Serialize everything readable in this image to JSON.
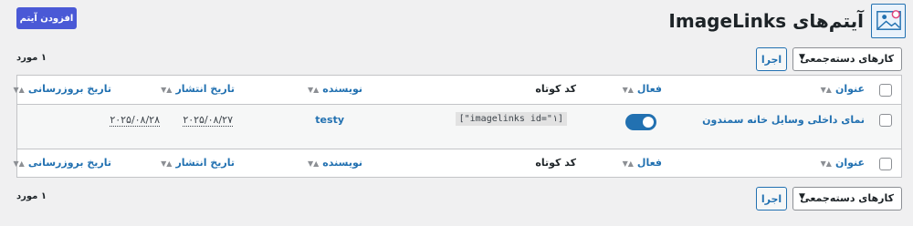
{
  "header": {
    "icon": "image-gallery-icon",
    "title": "آیتم‌های ImageLinks",
    "add_button": "افزودن آیتم"
  },
  "top_nav": {
    "item_count": "۱ مورد",
    "bulk_actions": {
      "selected": "کارهای دسته‌جمعی"
    },
    "apply_button": "اجرا"
  },
  "table": {
    "columns": {
      "title": "عنوان",
      "active": "فعال",
      "shortcode": "کد کوتاه",
      "author": "نویسنده",
      "published": "تاریخ انتشار",
      "updated": "تاریخ بروزرسانی"
    },
    "rows": [
      {
        "title": "نمای داخلی وسایل خانه سمندون",
        "active": true,
        "shortcode": "[imagelinks id=\"۱\"]",
        "author": "testy",
        "published": "۲۰۲۵/۰۸/۲۷",
        "updated": "۲۰۲۵/۰۸/۲۸"
      }
    ]
  },
  "bottom_nav": {
    "item_count": "۱ مورد",
    "bulk_actions": {
      "selected": "کارهای دسته‌جمعی"
    },
    "apply_button": "اجرا"
  },
  "colors": {
    "accent": "#2271b1",
    "add_button": "#4a59d6",
    "background": "#f0f0f1"
  }
}
